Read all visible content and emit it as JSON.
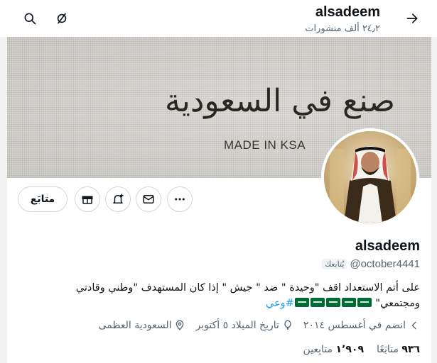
{
  "header": {
    "username": "alsadeem",
    "posts_count": "٢٤٫٢ ألف منشورات"
  },
  "banner": {
    "arabic_text": "صنع في السعودية",
    "english_text": "MADE IN KSA"
  },
  "actions": {
    "follow_label": "متابَع"
  },
  "profile": {
    "display_name": "alsadeem",
    "handle": "@october4441",
    "follows_you": "يُتابعك",
    "bio_line1": "على أتم الاستعداد اقف \"وحيدة \" ضد \" جيش \" إذا كان المستهدف \"وطني وقادتي",
    "bio_line2_start": "ومجتمعي\" ",
    "hashtag": "#وعي",
    "flag_count": 5,
    "location": "السعودية العظمى",
    "birthday": "تاريخ الميلاد ٥ أكتوبر",
    "joined": "انضم في أغسطس ٢٠١٤"
  },
  "stats": {
    "following_num": "٩٣٦",
    "following_label": "متابَعًا",
    "followers_num": "١٬٩٠٩",
    "followers_label": "متابِعين"
  },
  "colors": {
    "text_primary": "#0f1419",
    "text_secondary": "#536471",
    "link": "#1d9bf0",
    "border": "#cfd9de",
    "flag_green": "#006c35"
  }
}
